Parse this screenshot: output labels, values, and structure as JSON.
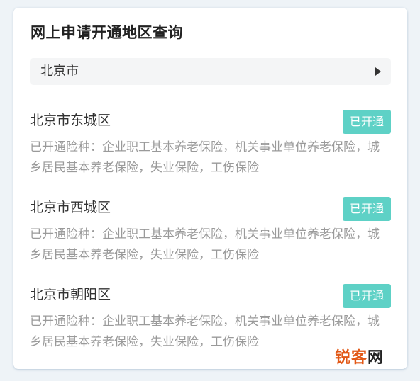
{
  "colors": {
    "accent": "#5ed1c6",
    "primary_text": "#333333",
    "secondary_text": "#9a9a9a",
    "select_bg": "#f4f5f6"
  },
  "page": {
    "title": "网上申请开通地区查询"
  },
  "city_select": {
    "value": "北京市",
    "icon": "caret-right-icon"
  },
  "districts": [
    {
      "name": "北京市东城区",
      "status": "已开通",
      "insurance": "已开通险种：企业职工基本养老保险，机关事业单位养老保险，城乡居民基本养老保险，失业保险，工伤保险"
    },
    {
      "name": "北京市西城区",
      "status": "已开通",
      "insurance": "已开通险种：企业职工基本养老保险，机关事业单位养老保险，城乡居民基本养老保险，失业保险，工伤保险"
    },
    {
      "name": "北京市朝阳区",
      "status": "已开通",
      "insurance": "已开通险种：企业职工基本养老保险，机关事业单位养老保险，城乡居民基本养老保险，失业保险，工伤保险"
    }
  ],
  "watermark": {
    "main": "锐客",
    "last": "网"
  }
}
